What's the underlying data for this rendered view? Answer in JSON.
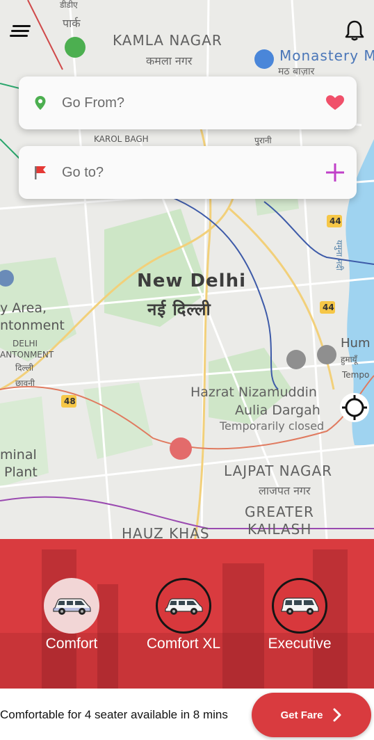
{
  "map": {
    "labels": {
      "dido_park_top": "डीडीए",
      "dido_park": "पार्क",
      "kamla_nagar": "KAMLA NAGAR",
      "kamla_nagar_hi": "कमला नगर",
      "monastery": "Monastery Ma",
      "monastery_hi": "मठ बाज़ार",
      "karol_bagh": "KAROL BAGH",
      "purani": "पुरानी",
      "new_delhi": "New Delhi",
      "new_delhi_hi": "नई दिल्ली",
      "army_area": "y Area,",
      "cantonment": "ntonment",
      "delhi_cant1": "DELHI",
      "delhi_cant2": "ANTONMENT",
      "delhi_cant_hi1": "दिल्ली",
      "delhi_cant_hi2": "छावनी",
      "hum": "Hum",
      "hum_hi": "हुमायूँ",
      "tempo": "Tempo",
      "nizamuddin1": "Hazrat Nizamuddin",
      "nizamuddin2": "Aulia Dargah",
      "temporarily_closed": "Temporarily closed",
      "terminal1": "minal",
      "terminal2": "Plant",
      "lajpat": "LAJPAT NAGAR",
      "lajpat_hi": "लाजपत नगर",
      "greater": "GREATER",
      "kailash": "KAILASH",
      "hauz_khas": "HAUZ KHAS",
      "road_44a": "44",
      "road_44b": "44",
      "road_48": "48",
      "yamuna_hi": "यमुना नदी"
    }
  },
  "header": {
    "menu_icon": "menu-icon",
    "bell_icon": "bell-icon"
  },
  "search": {
    "from_placeholder": "Go From?",
    "to_placeholder": "Go to?"
  },
  "vehicles": [
    {
      "label": "Comfort",
      "selected": true
    },
    {
      "label": "Comfort XL",
      "selected": false
    },
    {
      "label": "Executive",
      "selected": false
    }
  ],
  "footer": {
    "availability": "Comfortable for 4 seater available in 8 mins",
    "cta_label": "Get Fare"
  },
  "colors": {
    "accent": "#d93b3f",
    "heart": "#f0506a",
    "plus": "#c040c8",
    "pin": "#4caf50"
  }
}
